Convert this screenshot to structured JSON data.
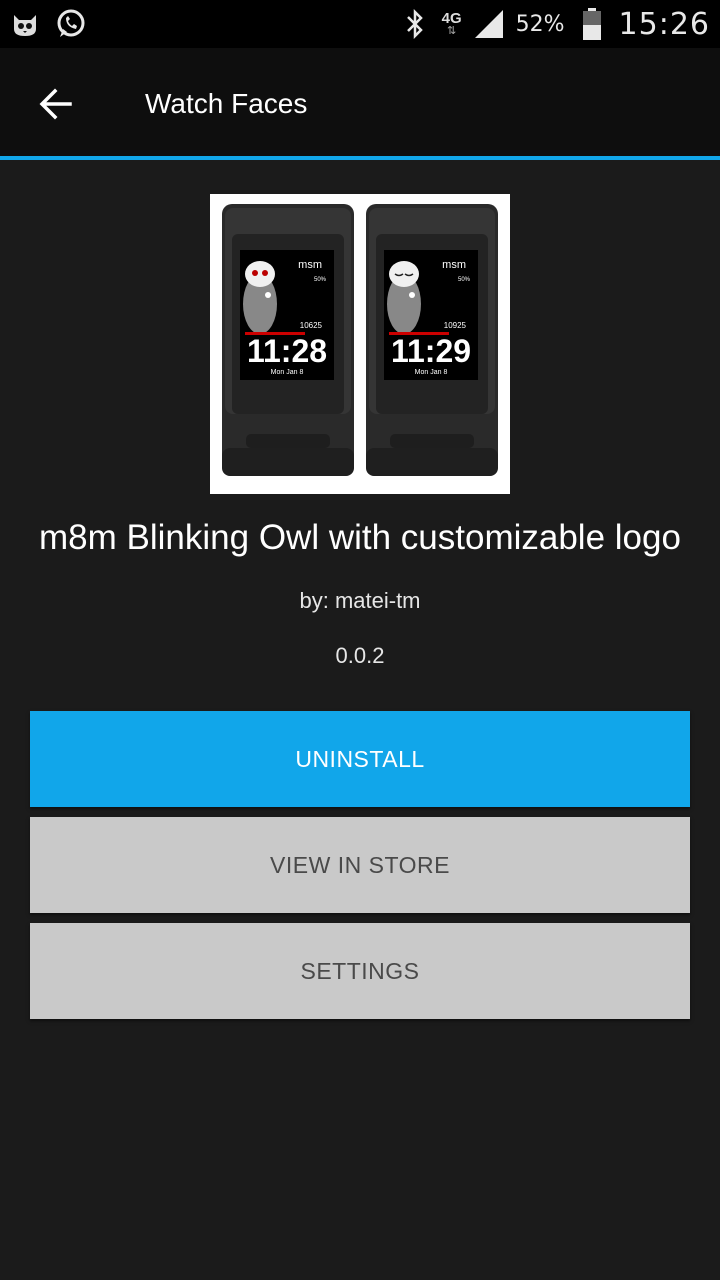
{
  "status_bar": {
    "network": "4G",
    "battery": "52%",
    "time": "15:26"
  },
  "toolbar": {
    "title": "Watch Faces"
  },
  "watch_preview": {
    "left": {
      "brand": "msm",
      "battery": "50%",
      "steps": "10625",
      "time": "11:28",
      "date": "Mon Jan 8"
    },
    "right": {
      "brand": "msm",
      "battery": "50%",
      "steps": "10925",
      "time": "11:29",
      "date": "Mon Jan 8"
    }
  },
  "app": {
    "name": "m8m Blinking Owl with customizable logo",
    "author": "by: matei-tm",
    "version": "0.0.2"
  },
  "actions": {
    "uninstall": "UNINSTALL",
    "view_in_store": "VIEW IN STORE",
    "settings": "SETTINGS"
  },
  "colors": {
    "accent": "#11a6ea",
    "background": "#1b1b1b",
    "secondary_button": "#c9c9c9"
  }
}
